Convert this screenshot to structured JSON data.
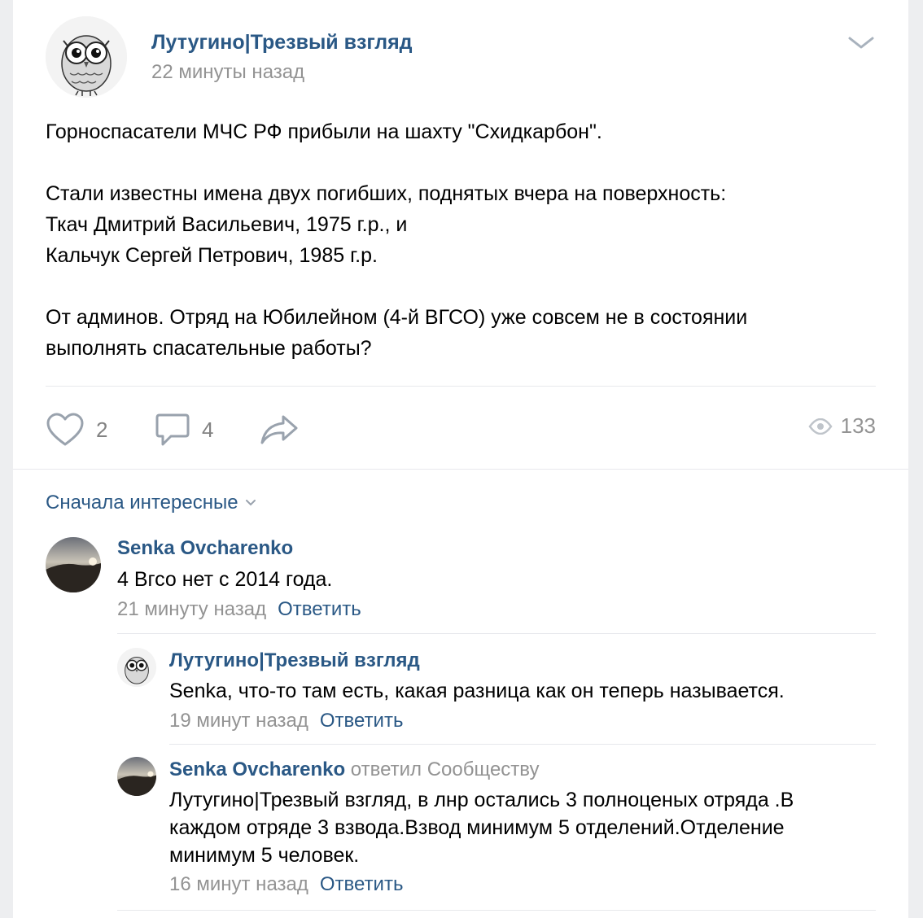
{
  "post": {
    "owner_name": "Лутугино|Трезвый взгляд",
    "time": "22 минуты назад",
    "paragraphs": [
      [
        "Горноспасатели МЧС РФ прибыли на шахту \"Схидкарбон\"."
      ],
      [
        "Стали известны имена двух погибших, поднятых вчера на поверхность:",
        "Ткач Дмитрий Васильевич, 1975 г.р., и",
        "Кальчук Сергей Петрович, 1985 г.р."
      ],
      [
        "От админов. Отряд на Юбилейном (4-й ВГСО) уже совсем не в состоянии",
        "выполнять спасательные работы?"
      ]
    ]
  },
  "actions": {
    "likes": "2",
    "comments": "4",
    "views": "133",
    "icons": [
      "heart-icon",
      "comment-icon",
      "share-icon",
      "eye-icon"
    ]
  },
  "comments_sort": {
    "label": "Сначала интересные"
  },
  "comments": [
    {
      "author": "Senka Ovcharenko",
      "reply_to": "",
      "text": "4 Вгсо нет с 2014 года.",
      "date": "21 минуту назад",
      "reply_label": "Ответить"
    },
    {
      "author": "Лутугино|Трезвый взгляд",
      "reply_to": "",
      "text": "Senka, что-то там есть, какая разница как он теперь называется.",
      "date": "19 минут назад",
      "reply_label": "Ответить"
    },
    {
      "author": "Senka Ovcharenko",
      "reply_to": "ответил Сообществу",
      "text_lines": [
        "Лутугино|Трезвый взгляд, в лнр остались 3 полноценых отряда .В",
        "каждом отряде 3 взвода.Взвод минимум 5 отделений.Отделение",
        "минимум 5 человек."
      ],
      "date": "16 минут назад",
      "reply_label": "Ответить"
    }
  ],
  "colors": {
    "link": "#2a5885",
    "muted": "#939393",
    "background": "#edeef0",
    "divider": "#e7e8ec"
  }
}
